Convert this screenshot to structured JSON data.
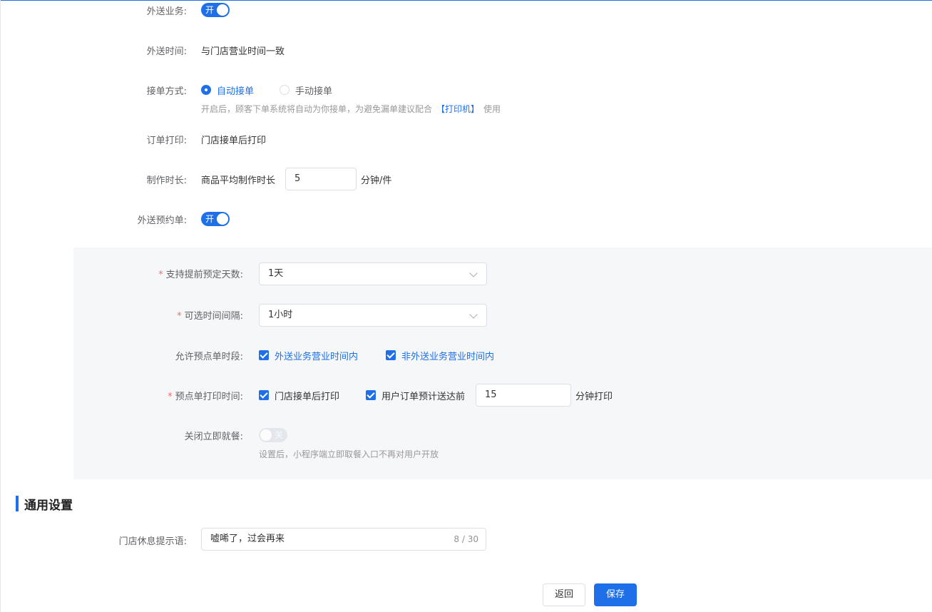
{
  "delivery": {
    "business_label": "外送业务:",
    "business_switch": "开",
    "time_label": "外送时间:",
    "time_value": "与门店营业时间一致",
    "accept_label": "接单方式:",
    "accept_auto": "自动接单",
    "accept_manual": "手动接单",
    "accept_hint_pre": "开启后，顾客下单系统将自动为你接单，为避免漏单建议配合",
    "accept_hint_link": "【打印机】",
    "accept_hint_post": "使用",
    "print_label": "订单打印:",
    "print_value": "门店接单后打印",
    "make_label": "制作时长:",
    "make_prefix": "商品平均制作时长",
    "make_value": "5",
    "make_unit": "分钟/件",
    "reserve_label": "外送预约单:",
    "reserve_switch": "开"
  },
  "reserve": {
    "days_label": "支持提前预定天数:",
    "days_value": "1天",
    "interval_label": "可选时间间隔:",
    "interval_value": "1小时",
    "period_label": "允许预点单时段:",
    "period_in": "外送业务营业时间内",
    "period_out": "非外送业务营业时间内",
    "printtime_label": "预点单打印时间:",
    "printtime_opt1": "门店接单后打印",
    "printtime_opt2": "用户订单预计送达前",
    "printtime_value": "15",
    "printtime_unit": "分钟打印",
    "close_label": "关闭立即就餐:",
    "close_switch": "关",
    "close_hint": "设置后，小程序端立即取餐入口不再对用户开放",
    "required_mark": "*"
  },
  "general": {
    "title": "通用设置",
    "rest_label": "门店休息提示语:",
    "rest_value": "嘘唏了，过会再来",
    "rest_counter": "8 / 30"
  },
  "footer": {
    "back_label": "返回",
    "save_label": "保存"
  },
  "colors": {
    "accent": "#1e6fe8",
    "required": "#f56c6c",
    "panel_bg": "#f6f7f9"
  }
}
